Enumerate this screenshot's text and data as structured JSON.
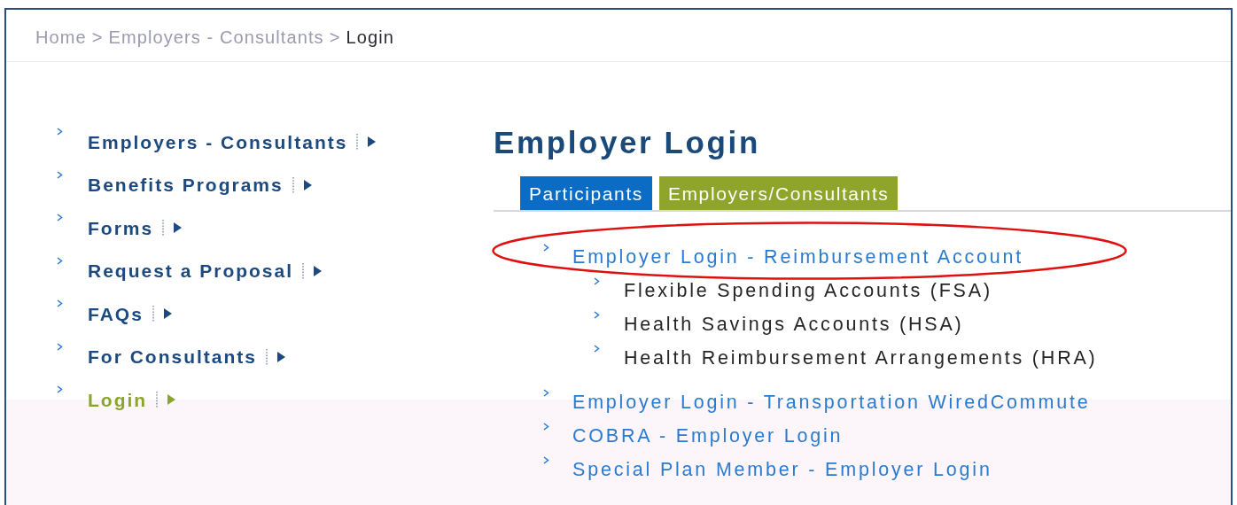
{
  "breadcrumb": [
    {
      "label": "Home",
      "current": false,
      "separator": ">"
    },
    {
      "label": "Employers - Consultants",
      "current": false,
      "separator": ">"
    },
    {
      "label": "Login",
      "current": true
    }
  ],
  "sidebar": {
    "items": [
      {
        "label": "Employers - Consultants",
        "selected": false
      },
      {
        "label": "Benefits Programs",
        "selected": false
      },
      {
        "label": "Forms",
        "selected": false
      },
      {
        "label": "Request a Proposal",
        "selected": false
      },
      {
        "label": "FAQs",
        "selected": false
      },
      {
        "label": "For Consultants",
        "selected": false
      },
      {
        "label": "Login",
        "selected": true
      }
    ]
  },
  "page": {
    "title": "Employer Login"
  },
  "tabs": [
    {
      "label": "Participants",
      "selected": false
    },
    {
      "label": "Employers/Consultants",
      "selected": true
    }
  ],
  "links": [
    {
      "label": "Employer Login - Reimbursement Account",
      "circled": true,
      "children": [
        {
          "label": "Flexible Spending Accounts (FSA)"
        },
        {
          "label": "Health Savings Accounts (HSA)"
        },
        {
          "label": "Health Reimbursement Arrangements (HRA)"
        }
      ]
    },
    {
      "label": "Employer Login - Transportation WiredCommute",
      "circled": false
    },
    {
      "label": "COBRA - Employer Login",
      "circled": false
    },
    {
      "label": "Special Plan Member - Employer Login",
      "circled": false
    }
  ]
}
